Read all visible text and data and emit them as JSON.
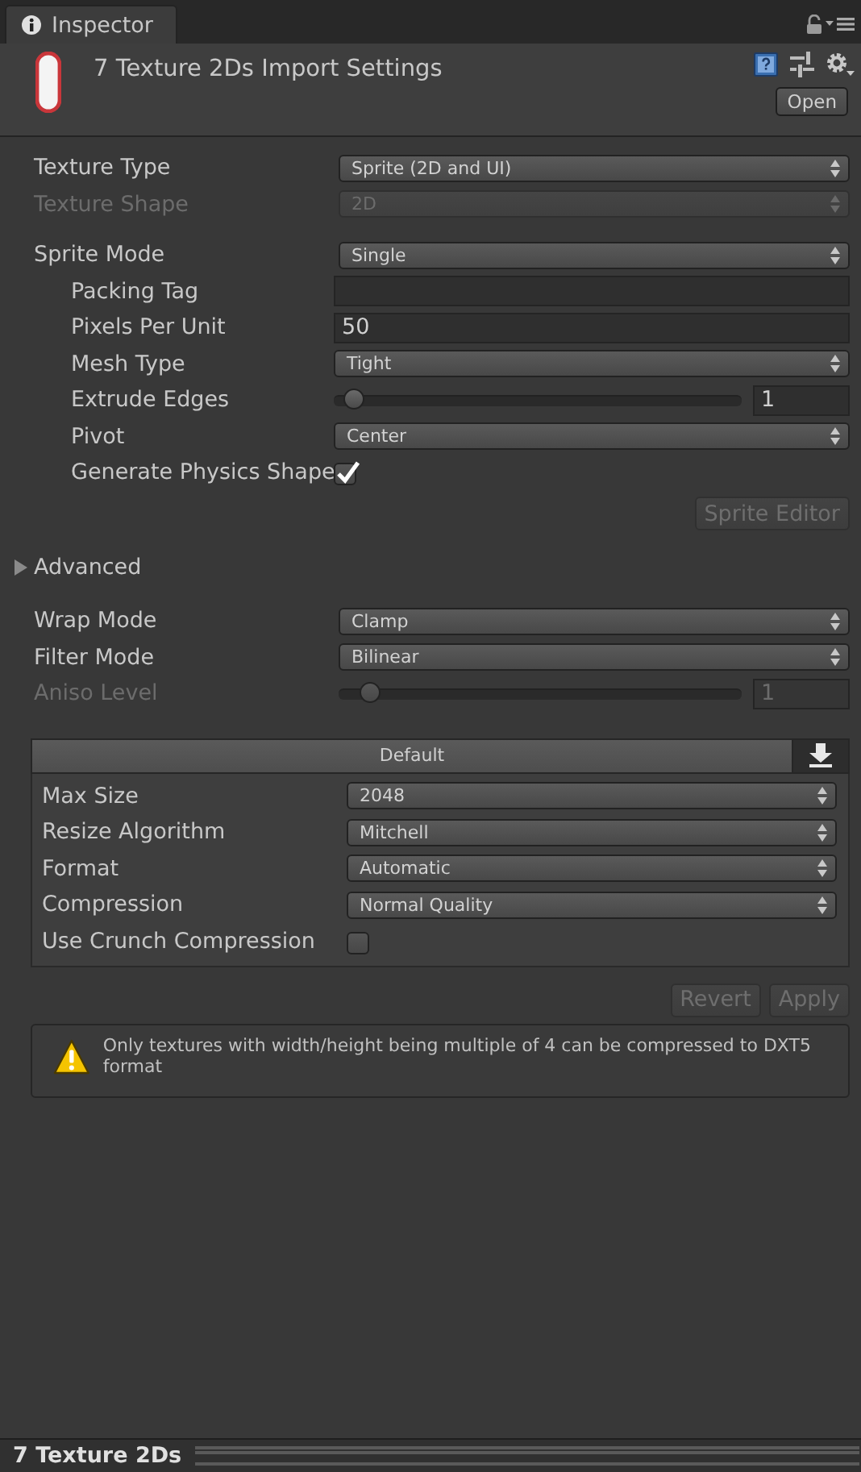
{
  "tab": {
    "label": "Inspector"
  },
  "header": {
    "title": "7 Texture 2Ds Import Settings",
    "open_button": "Open"
  },
  "texture_settings": [
    {
      "kind": "dropdown",
      "label": "Texture Type",
      "value": "Sprite (2D and UI)",
      "disabled": false
    },
    {
      "kind": "dropdown",
      "label": "Texture Shape",
      "value": "2D",
      "disabled": true
    }
  ],
  "sprite_settings": [
    {
      "kind": "dropdown",
      "label": "Sprite Mode",
      "value": "Single",
      "disabled": false,
      "children": [
        {
          "kind": "field",
          "label": "Packing Tag",
          "disabled": false
        },
        {
          "kind": "field",
          "label": "Pixels Per Unit",
          "value": "50",
          "disabled": false
        },
        {
          "kind": "dropdown",
          "label": "Mesh Type",
          "value": "Tight",
          "disabled": false
        },
        {
          "kind": "slider",
          "label": "Extrude Edges",
          "value": "1",
          "level": 0.03,
          "disabled": false
        },
        {
          "kind": "dropdown",
          "label": "Pivot",
          "value": "Center",
          "disabled": false
        },
        {
          "kind": "checkbox",
          "label": "Generate Physics Shape",
          "checked": true,
          "disabled": false
        }
      ]
    }
  ],
  "sprite_editor_button": {
    "label": "Sprite Editor",
    "disabled": true
  },
  "advanced": {
    "label": "Advanced",
    "expanded": false
  },
  "sampling_settings": [
    {
      "kind": "dropdown",
      "label": "Wrap Mode",
      "value": "Clamp",
      "disabled": false
    },
    {
      "kind": "dropdown",
      "label": "Filter Mode",
      "value": "Bilinear",
      "disabled": false
    },
    {
      "kind": "slider",
      "label": "Aniso Level",
      "value": "1",
      "level": 0.06,
      "disabled": true
    }
  ],
  "platform": {
    "tab": {
      "label": "Default"
    },
    "settings": [
      {
        "kind": "dropdown",
        "label": "Max Size",
        "value": "2048",
        "disabled": false
      },
      {
        "kind": "dropdown",
        "label": "Resize Algorithm",
        "value": "Mitchell",
        "disabled": false
      },
      {
        "kind": "dropdown",
        "label": "Format",
        "value": "Automatic",
        "disabled": false
      },
      {
        "kind": "dropdown",
        "label": "Compression",
        "value": "Normal Quality",
        "disabled": false
      },
      {
        "kind": "checkbox",
        "label": "Use Crunch Compression",
        "checked": false,
        "disabled": false
      }
    ]
  },
  "buttons": [
    {
      "label": "Revert",
      "disabled": true
    },
    {
      "label": "Apply",
      "disabled": true
    }
  ],
  "warning": {
    "text": "Only textures with width/height being multiple of 4 can be compressed to DXT5 format"
  },
  "footer": {
    "title": "7 Texture 2Ds"
  }
}
